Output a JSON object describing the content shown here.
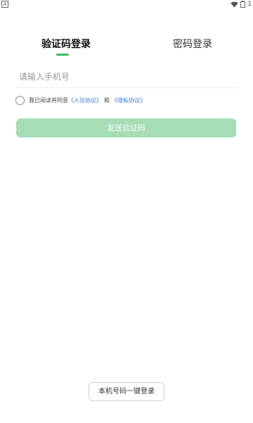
{
  "status_bar": {
    "left_glyph": "A",
    "right_text": "1",
    "icons": [
      "wifi-icon",
      "battery-icon"
    ]
  },
  "tabs": [
    {
      "label": "验证码登录",
      "active": true
    },
    {
      "label": "密码登录",
      "active": false
    }
  ],
  "phone_input": {
    "placeholder": "请输入手机号",
    "value": ""
  },
  "agreement": {
    "prefix": "我已阅读并同意",
    "link1": "《入驻协议》",
    "and": "和",
    "link2": "《隐私协议》",
    "checked": false
  },
  "send_code_button": {
    "label": "发送验证码"
  },
  "one_click_login_button": {
    "label": "本机号码一键登录"
  },
  "colors": {
    "accent": "#3fb66b",
    "button_disabled": "#a6ddb7",
    "link": "#3a79d8"
  }
}
